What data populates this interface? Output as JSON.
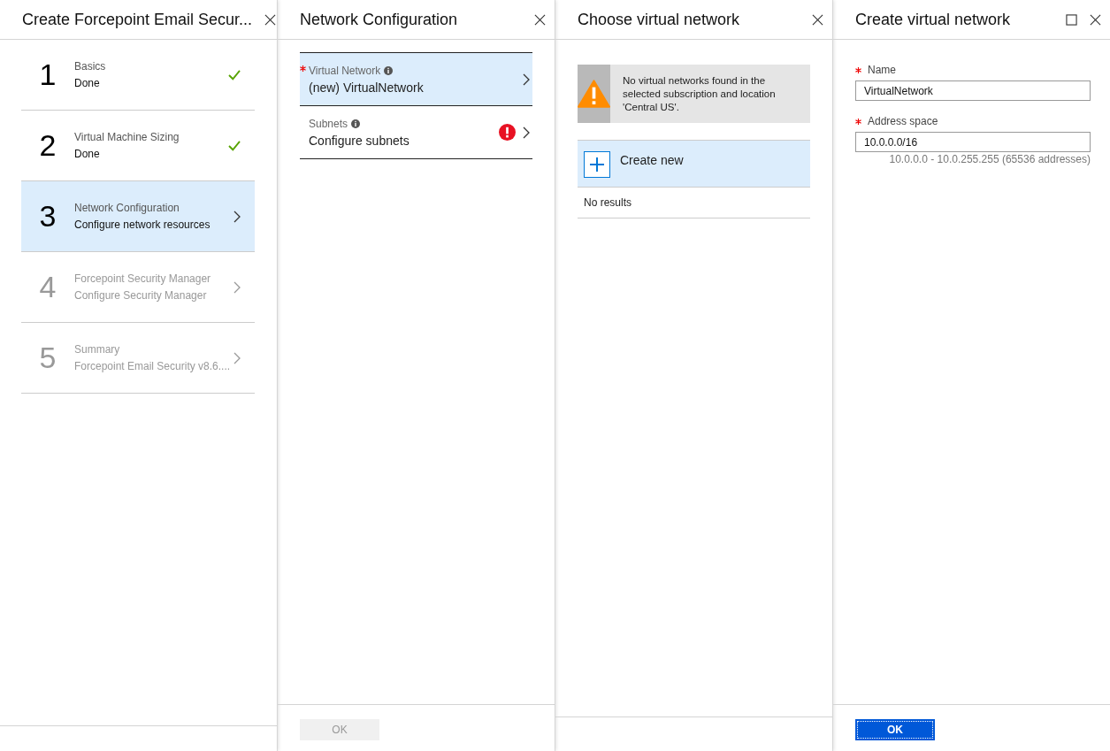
{
  "wizard": {
    "title": "Create Forcepoint Email Secur...",
    "steps": [
      {
        "number": "1",
        "title": "Basics",
        "subtitle": "Done",
        "kind": "done",
        "selected": false
      },
      {
        "number": "2",
        "title": "Virtual Machine Sizing",
        "subtitle": "Done",
        "kind": "done",
        "selected": false
      },
      {
        "number": "3",
        "title": "Network Configuration",
        "subtitle": "Configure network resources",
        "kind": "current",
        "selected": true
      },
      {
        "number": "4",
        "title": "Forcepoint Security Manager",
        "subtitle": "Configure Security Manager",
        "kind": "locked",
        "selected": false
      },
      {
        "number": "5",
        "title": "Summary",
        "subtitle": "Forcepoint Email Security v8.6....",
        "kind": "locked",
        "selected": false
      }
    ]
  },
  "network_configuration": {
    "title": "Network Configuration",
    "items": [
      {
        "label": "Virtual Network",
        "value": "(new) VirtualNetwork",
        "required": true,
        "error": false,
        "selected": true
      },
      {
        "label": "Subnets",
        "value": "Configure subnets",
        "required": false,
        "error": true,
        "selected": false
      }
    ],
    "ok_button": {
      "label": "OK",
      "disabled": true
    }
  },
  "choose_virtual_network": {
    "title": "Choose virtual network",
    "warning": "No virtual networks found in the selected subscription and location 'Central US'.",
    "create_new": "Create new",
    "empty_text": "No results"
  },
  "create_virtual_network": {
    "title": "Create virtual network",
    "fields": [
      {
        "label": "Name",
        "value": "VirtualNetwork",
        "required": true
      },
      {
        "label": "Address space",
        "value": "10.0.0.0/16",
        "required": true,
        "hint": "10.0.0.0 - 10.0.255.255 (65536 addresses)"
      }
    ],
    "ok_button": {
      "label": "OK",
      "disabled": false
    }
  }
}
